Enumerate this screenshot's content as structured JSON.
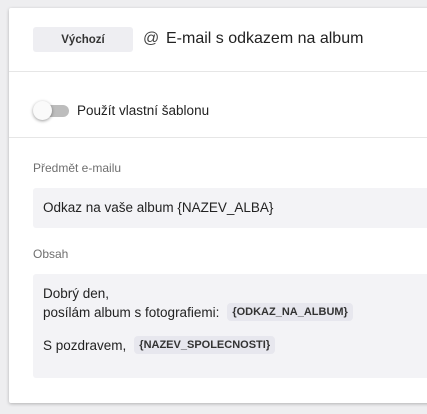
{
  "header": {
    "badge": "Výchozí",
    "icon": "at-icon",
    "title": "E-mail s odkazem na album"
  },
  "toggle": {
    "label": "Použít vlastní šablonu",
    "checked": false
  },
  "subject": {
    "label": "Předmět e-mailu",
    "value": "Odkaz na vaše album {NAZEV_ALBA}"
  },
  "content": {
    "label": "Obsah",
    "line1": "Dobrý den,",
    "line2": "posílám album s fotografiemi:",
    "token1": "{ODKAZ_NA_ALBUM}",
    "line3": "S pozdravem,",
    "token2": "{NAZEV_SPOLECNOSTI}"
  }
}
